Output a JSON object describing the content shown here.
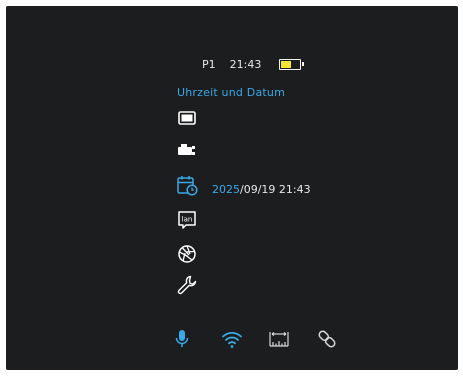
{
  "status": {
    "profile": "P1",
    "time": "21:43",
    "battery_level": 0.55,
    "battery_color": "#f4e532"
  },
  "menu": {
    "title": "Uhrzeit und Datum",
    "accent_color": "#3aa9e8",
    "items": [
      {
        "icon": "display-icon"
      },
      {
        "icon": "camera-recorder-icon"
      },
      {
        "icon": "calendar-clock-icon",
        "year": "2025",
        "date_rest": "/09/19 21:43"
      },
      {
        "icon": "language-icon",
        "icon_text": "lan"
      },
      {
        "icon": "aperture-icon"
      },
      {
        "icon": "wrench-icon"
      }
    ]
  },
  "bottom_bar": {
    "items": [
      {
        "icon": "microphone-icon",
        "active": true
      },
      {
        "icon": "wifi-icon",
        "active": true
      },
      {
        "icon": "rangefinder-icon",
        "active": false
      },
      {
        "icon": "link-icon",
        "active": false
      }
    ]
  }
}
